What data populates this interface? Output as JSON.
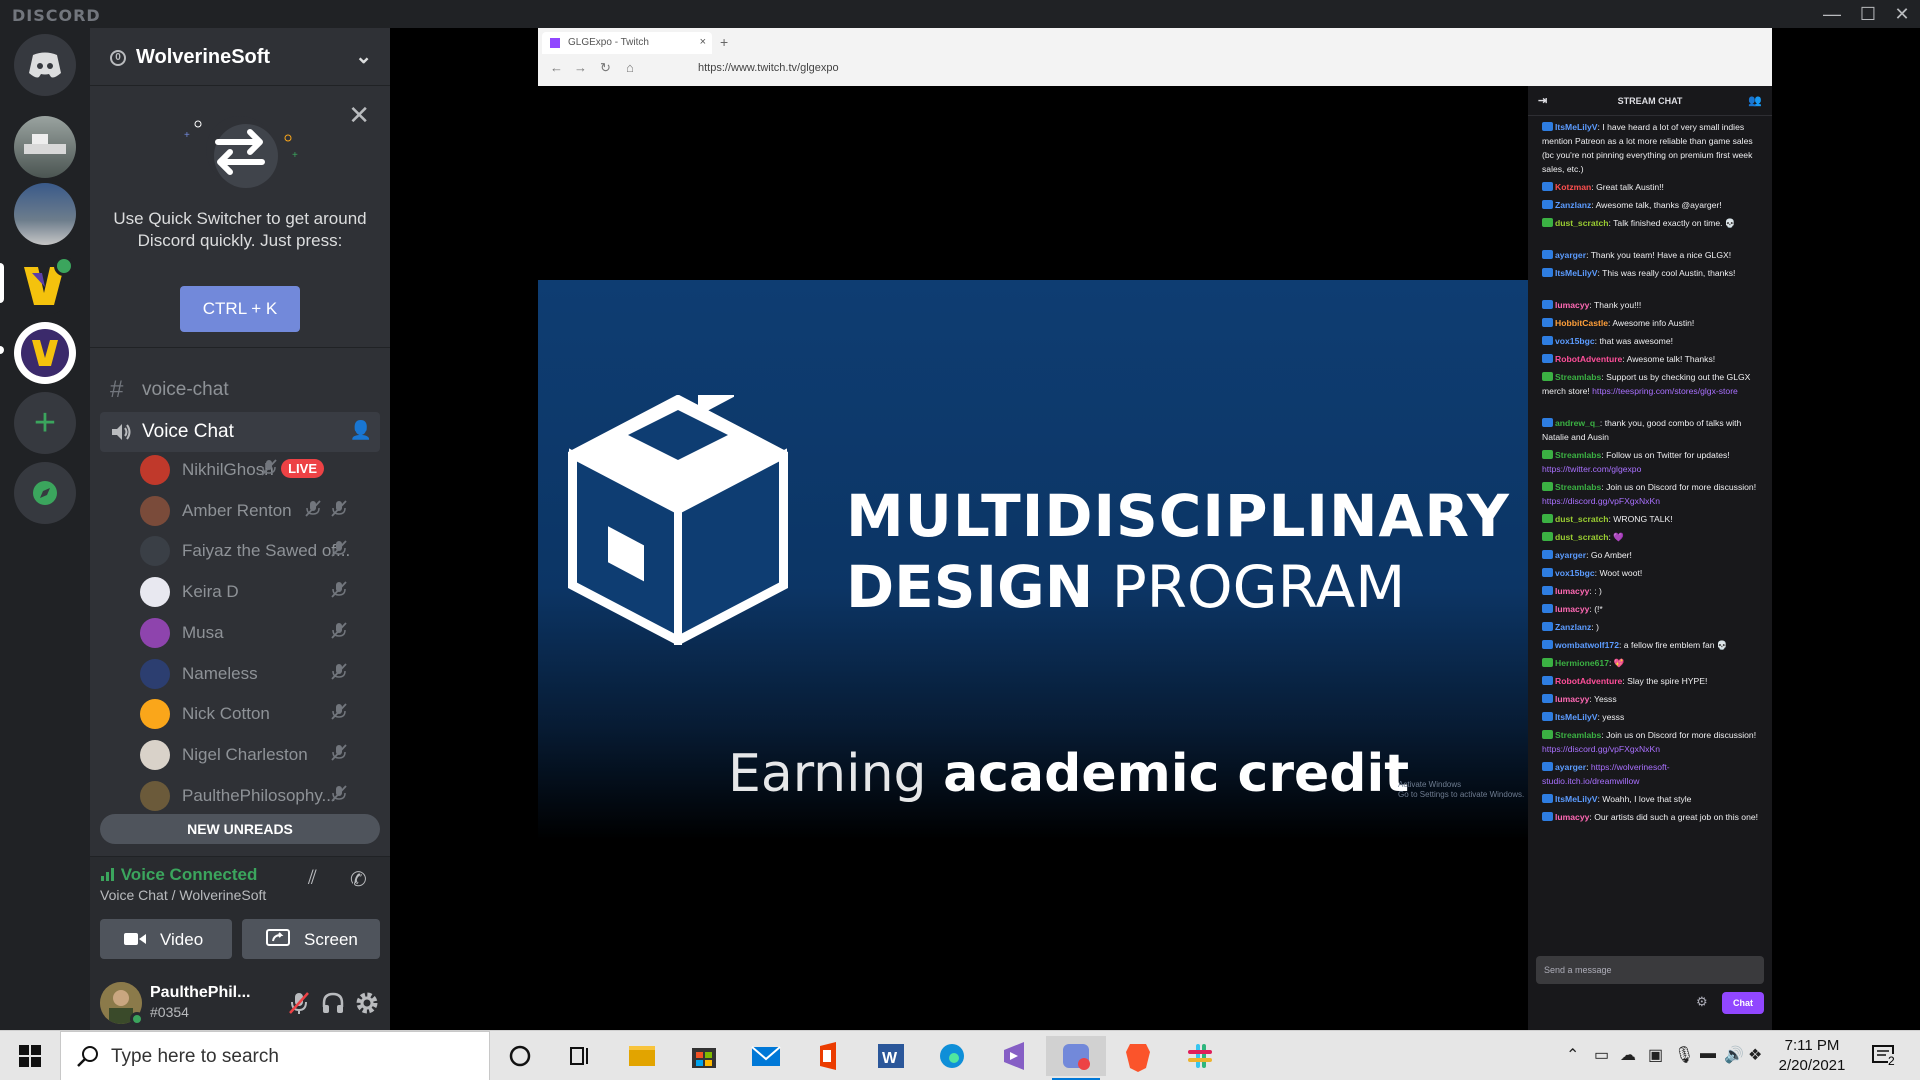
{
  "app": {
    "brand": "DISCORD"
  },
  "window_controls": {
    "minimize": "—",
    "maximize": "☐",
    "close": "✕"
  },
  "guild": {
    "name": "WolverineSoft",
    "badge": "0"
  },
  "quick_switcher": {
    "text_line1": "Use Quick Switcher to get around",
    "text_line2": "Discord quickly. Just press:",
    "shortcut": "CTRL + K",
    "close": "✕"
  },
  "channels": {
    "text_channel": "voice-chat",
    "voice_channel": "Voice Chat"
  },
  "voice_users": [
    {
      "name": "NikhilGhosh",
      "live": "LIVE",
      "color": "#c0392b"
    },
    {
      "name": "Amber Renton",
      "color": "#7a4b3a"
    },
    {
      "name": "Faiyaz the Sawed of...",
      "color": "#3a3f46"
    },
    {
      "name": "Keira D",
      "color": "#e8e8f0"
    },
    {
      "name": "Musa",
      "color": "#8e44ad"
    },
    {
      "name": "Nameless",
      "color": "#2c3e70"
    },
    {
      "name": "Nick Cotton",
      "color": "#faa61a"
    },
    {
      "name": "Nigel Charleston",
      "color": "#d9d2c9"
    },
    {
      "name": "PaulthePhilosophy...",
      "color": "#6b5a3a"
    }
  ],
  "new_unreads": "NEW UNREADS",
  "rtc": {
    "status": "Voice Connected",
    "channel": "Voice Chat / WolverineSoft",
    "video": "Video",
    "screen": "Screen"
  },
  "user": {
    "name": "PaulthePhil...",
    "tag": "#0354"
  },
  "browser": {
    "tab_title": "GLGExpo - Twitch",
    "url": "https://www.twitch.tv/glgexpo"
  },
  "slide": {
    "title_line1": "MULTIDISCIPLINARY",
    "title_line2_bold": "DESIGN",
    "title_line2": "PROGRAM",
    "subtitle_light": "Earning",
    "subtitle_bold": "academic credit",
    "watermark_line1": "Activate Windows",
    "watermark_line2": "Go to Settings to activate Windows."
  },
  "stream_chat": {
    "header": "STREAM CHAT",
    "messages": [
      {
        "user": "ItsMeLilyV",
        "color": "#5c9cff",
        "text": "I have heard a lot of very small indies mention Patreon as a lot more reliable than game sales (bc you're not pinning everything on premium first week sales, etc.)"
      },
      {
        "user": "Kotzman",
        "color": "#ff4f4f",
        "text": "Great talk Austin!!"
      },
      {
        "user": "Zanzlanz",
        "color": "#5c9cff",
        "text": "Awesome talk, thanks @ayarger!"
      },
      {
        "user": "dust_scratch",
        "color": "#9acd32",
        "text": "Talk finished exactly on time. 💀"
      },
      {
        "user": "ayarger",
        "color": "#5c9cff",
        "text": "Thank you team! Have a nice GLGX!"
      },
      {
        "user": "ItsMeLilyV",
        "color": "#5c9cff",
        "text": "This was really cool Austin, thanks!"
      },
      {
        "user": "lumacyy",
        "color": "#ff69b4",
        "text": "Thank you!!!"
      },
      {
        "user": "HobbitCastle",
        "color": "#ff9f3a",
        "text": "Awesome info Austin!"
      },
      {
        "user": "vox15bgc",
        "color": "#5c9cff",
        "text": "that was awesome!"
      },
      {
        "user": "RobotAdventure",
        "color": "#ff4f9a",
        "text": "Awesome talk! Thanks!"
      },
      {
        "user": "Streamlabs",
        "color": "#3bb143",
        "text": "Support us by checking out the GLGX merch store!",
        "link": "https://teespring.com/stores/glgx-store"
      },
      {
        "user": "andrew_q_",
        "color": "#3bb143",
        "text": "thank you, good combo of talks with Natalie and Ausin"
      },
      {
        "user": "Streamlabs",
        "color": "#3bb143",
        "text": "Follow us on Twitter for updates!",
        "link": "https://twitter.com/glgexpo"
      },
      {
        "user": "Streamlabs",
        "color": "#3bb143",
        "text": "Join us on Discord for more discussion!",
        "link": "https://discord.gg/vpFXgxNxKn"
      },
      {
        "user": "dust_scratch",
        "color": "#9acd32",
        "text": "WRONG TALK!"
      },
      {
        "user": "dust_scratch",
        "color": "#9acd32",
        "text": "💜"
      },
      {
        "user": "ayarger",
        "color": "#5c9cff",
        "text": "Go Amber!"
      },
      {
        "user": "vox15bgc",
        "color": "#5c9cff",
        "text": "Woot woot!"
      },
      {
        "user": "lumacyy",
        "color": "#ff69b4",
        "text": ": )"
      },
      {
        "user": "lumacyy",
        "color": "#ff69b4",
        "text": "(!*"
      },
      {
        "user": "Zanzlanz",
        "color": "#5c9cff",
        "text": ")"
      },
      {
        "user": "wombatwolf172",
        "color": "#5c9cff",
        "text": "a fellow fire emblem fan 💀"
      },
      {
        "user": "Hermione617",
        "color": "#3bb143",
        "text": "💖"
      },
      {
        "user": "RobotAdventure",
        "color": "#ff4f9a",
        "text": "Slay the spire HYPE!"
      },
      {
        "user": "lumacyy",
        "color": "#ff69b4",
        "text": "Yesss"
      },
      {
        "user": "ItsMeLilyV",
        "color": "#5c9cff",
        "text": "yesss"
      },
      {
        "user": "Streamlabs",
        "color": "#3bb143",
        "text": "Join us on Discord for more discussion!",
        "link": "https://discord.gg/vpFXgxNxKn"
      },
      {
        "user": "ayarger",
        "color": "#5c9cff",
        "text": "",
        "link": "https://wolverinesoft-studio.itch.io/dreamwillow"
      },
      {
        "user": "ItsMeLilyV",
        "color": "#5c9cff",
        "text": "Woahh, I love that style"
      },
      {
        "user": "lumacyy",
        "color": "#ff69b4",
        "text": "Our artists did such a great job on this one!"
      }
    ],
    "send_placeholder": "Send a message",
    "chat_button": "Chat"
  },
  "taskbar": {
    "search_placeholder": "Type here to search",
    "time": "7:11 PM",
    "date": "2/20/2021",
    "notif_count": "2"
  },
  "colors": {
    "discord_blurple": "#7289da",
    "voice_green": "#3ba55d",
    "live_red": "#ed4245",
    "twitch_purple": "#9147ff"
  }
}
